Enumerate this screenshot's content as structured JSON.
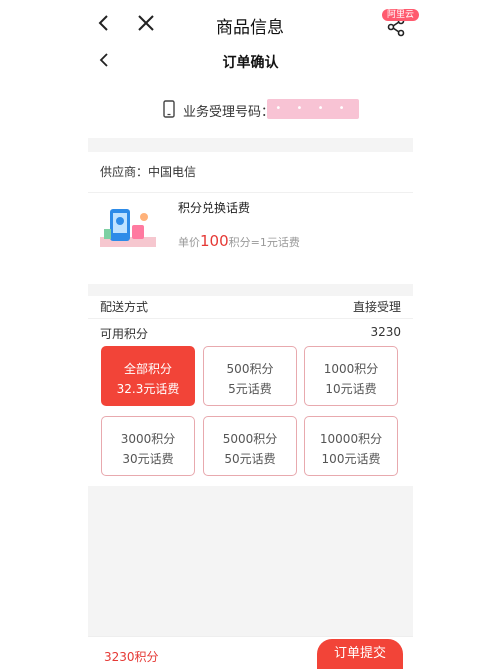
{
  "outer": {
    "title": "商品信息",
    "badge": "阿里云"
  },
  "inner": {
    "title": "订单确认"
  },
  "business": {
    "label": "业务受理号码：",
    "masked_value": "• • • • • •"
  },
  "supplier": {
    "label": "供应商：中国电信"
  },
  "product": {
    "name": "积分兑换话费",
    "price_prefix": "单价",
    "price_value": "100",
    "price_unit": "积分",
    "price_suffix": "=1元话费"
  },
  "delivery": {
    "label": "配送方式",
    "value": "直接受理"
  },
  "available": {
    "label": "可用积分",
    "value": "3230"
  },
  "options": [
    {
      "line1": "全部积分",
      "line2": "32.3元话费",
      "selected": true
    },
    {
      "line1": "500积分",
      "line2": "5元话费",
      "selected": false
    },
    {
      "line1": "1000积分",
      "line2": "10元话费",
      "selected": false
    },
    {
      "line1": "3000积分",
      "line2": "30元话费",
      "selected": false
    },
    {
      "line1": "5000积分",
      "line2": "50元话费",
      "selected": false
    },
    {
      "line1": "10000积分",
      "line2": "100元话费",
      "selected": false
    }
  ],
  "footer": {
    "points_total": "3230积分",
    "submit_label": "订单提交"
  },
  "colors": {
    "accent": "#f24438",
    "option_border": "#e8a9ae",
    "mask": "#f8c3d4"
  }
}
